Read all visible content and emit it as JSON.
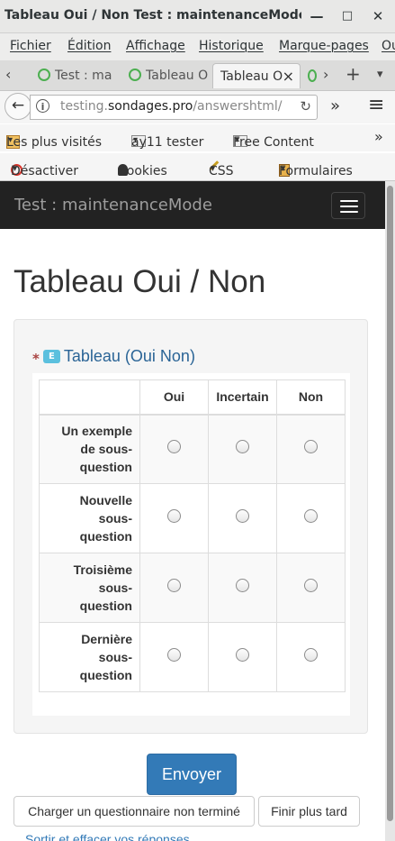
{
  "window": {
    "title": "Tableau Oui / Non Test : maintenanceMode - Mo...",
    "minimize": "—",
    "maximize": "□",
    "close": "✕"
  },
  "menu": [
    "Fichier",
    "Édition",
    "Affichage",
    "Historique",
    "Marque-pages",
    "Ou"
  ],
  "tabs": [
    {
      "label": "Test : ma"
    },
    {
      "label": "Tableau O"
    },
    {
      "label": "Tableau O"
    }
  ],
  "tab_controls": {
    "scroll_left": "‹",
    "scroll_right": "›",
    "new_tab": "+",
    "list": "▾",
    "close": "×"
  },
  "nav": {
    "back": "←",
    "url_prefix": "testing.",
    "url_domain": "sondages.pro",
    "url_path": "/answershtml/",
    "reload": "↻",
    "overflow": "»",
    "menu": "≡"
  },
  "bookmarks": [
    "Les plus visités",
    "ay11 tester",
    "Free Content"
  ],
  "devtoolbar": [
    "Désactiver",
    "Cookies",
    "CSS",
    "Formulaires"
  ],
  "site": {
    "brand": "Test : maintenanceMode",
    "page_title": "Tableau Oui / Non",
    "question": {
      "asterisk": "*",
      "badge": "E",
      "text": "Tableau (Oui Non)",
      "columns": [
        "Oui",
        "Incertain",
        "Non"
      ],
      "rows": [
        [
          "Un exemple",
          "de sous-",
          "question"
        ],
        [
          "Nouvelle",
          "sous-",
          "question"
        ],
        [
          "Troisième",
          "sous-",
          "question"
        ],
        [
          "Dernière",
          "sous-",
          "question"
        ]
      ]
    },
    "buttons": {
      "send": "Envoyer",
      "load": "Charger un questionnaire non terminé",
      "later": "Finir plus tard",
      "exit": "Sortir et effacer vos réponses"
    }
  },
  "colors": {
    "primary": "#337ab7",
    "navbar": "#222222",
    "badge": "#5bc0de",
    "asterisk": "#a94442"
  }
}
